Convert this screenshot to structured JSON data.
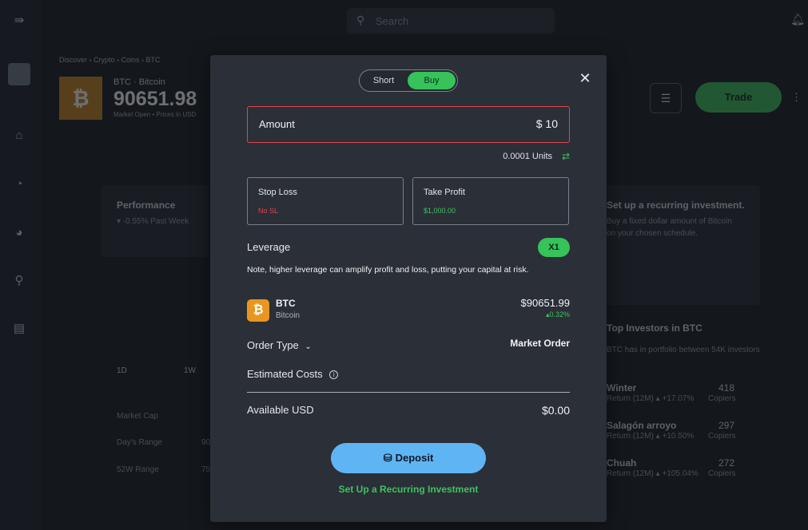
{
  "background": {
    "search_placeholder": "Search",
    "breadcrumb": "Discover  ›  Crypto  ›  Coins  ›  BTC",
    "symbol_line": "BTC  ·  Bitcoin",
    "price": "90651.98",
    "status_line": "Market Open  •  Prices in USD",
    "trade_label": "Trade",
    "performance_title": "Performance",
    "performance_sub": "▾ -0.55%  Past Week",
    "recurring_title": "Set up a recurring investment.",
    "recurring_text1": "Buy a fixed dollar amount of Bitcoin",
    "recurring_text2": "on your chosen schedule.",
    "investors_title": "Top Investors in BTC",
    "investors_sub": "BTC has in portfolio between 54K investors",
    "investors": [
      {
        "name": "Winter",
        "sub": "Return (12M) ▴ +17.07%",
        "count": "418",
        "count_label": "Copiers"
      },
      {
        "name": "Salagón arroyo",
        "sub": "Return (12M) ▴ +10.50%",
        "count": "297",
        "count_label": "Copiers"
      },
      {
        "name": "Chuah",
        "sub": "Return (12M) ▴ +105.04%",
        "count": "272",
        "count_label": "Copiers"
      }
    ],
    "stats": [
      {
        "label": "Market Cap",
        "value": ""
      },
      {
        "label": "Day's Range",
        "value": "90"
      },
      {
        "label": "52W Range",
        "value": "75"
      }
    ],
    "range_tabs": [
      "1D",
      "1W"
    ]
  },
  "modal": {
    "toggle_short": "Short",
    "toggle_buy": "Buy",
    "close_symbol": "✕",
    "amount_label": "Amount",
    "amount_value": "$  10",
    "units": "0.0001 Units",
    "stop_loss_label": "Stop Loss",
    "stop_loss_value": "No SL",
    "take_profit_label": "Take Profit",
    "take_profit_value": "$1,000.00",
    "leverage_label": "Leverage",
    "leverage_value": "X1",
    "note": "Note, higher leverage can amplify profit and loss, putting your capital at risk.",
    "coin_symbol": "BTC",
    "coin_name": "Bitcoin",
    "coin_price": "$90651.99",
    "coin_change": "▴0.32%",
    "order_type_label": "Order Type",
    "order_type_value": "Market Order",
    "estimated_costs_label": "Estimated Costs",
    "available_label": "Available USD",
    "available_value": "$0.00",
    "deposit_label": "Deposit",
    "recurring_link": "Set Up a Recurring Investment"
  },
  "colors": {
    "accent_green": "#35c35a",
    "error_red": "#e0464c",
    "deposit_blue": "#5fb4f4",
    "modal_bg": "#2b2f37"
  },
  "icons": [
    "menu-icon",
    "home-icon",
    "portfolio-icon",
    "pie-chart-icon",
    "search-icon",
    "news-icon",
    "bell-icon",
    "close-icon",
    "swap-icon",
    "chevron-down-icon",
    "info-icon",
    "bitcoin-icon",
    "deposit-icon"
  ]
}
